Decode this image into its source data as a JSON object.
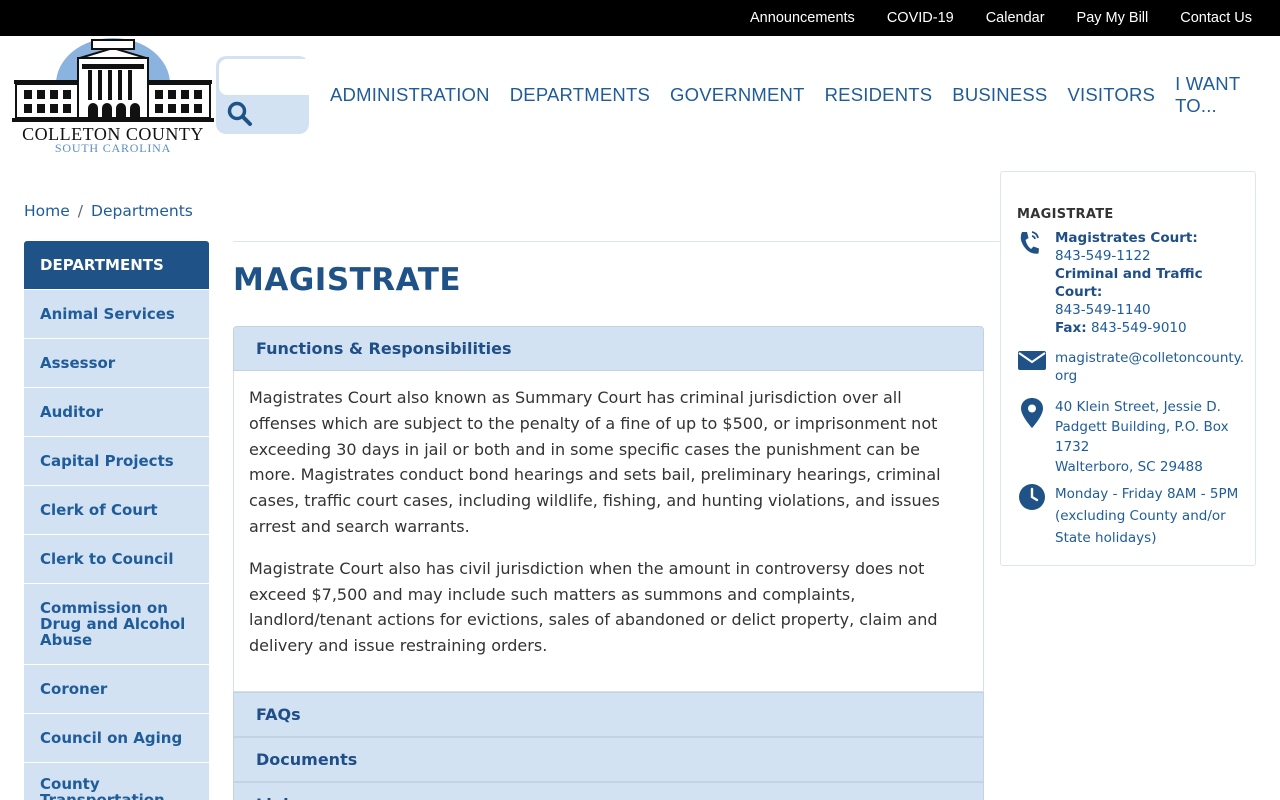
{
  "top_links": [
    "Announcements",
    "COVID-19",
    "Calendar",
    "Pay My Bill",
    "Contact Us"
  ],
  "logo": {
    "name": "COLLETON COUNTY",
    "state": "SOUTH CAROLINA"
  },
  "search": {
    "placeholder": ""
  },
  "main_nav": [
    "ADMINISTRATION",
    "DEPARTMENTS",
    "GOVERNMENT",
    "RESIDENTS",
    "BUSINESS",
    "VISITORS",
    "I WANT TO..."
  ],
  "breadcrumb": {
    "home": "Home",
    "separator": "/",
    "current": "Departments"
  },
  "sidenav": {
    "heading": "DEPARTMENTS",
    "items": [
      "Animal Services",
      "Assessor",
      "Auditor",
      "Capital Projects",
      "Clerk of Court",
      "Clerk to Council",
      "Commission on Drug and Alcohol Abuse",
      "Coroner",
      "Council on Aging",
      "County Transportation"
    ]
  },
  "page": {
    "title": "MAGISTRATE",
    "accordion": [
      {
        "label": "Functions & Responsibilities",
        "expanded": true
      },
      {
        "label": "FAQs",
        "expanded": false
      },
      {
        "label": "Documents",
        "expanded": false
      },
      {
        "label": "Links",
        "expanded": false
      }
    ],
    "body": [
      "Magistrates Court also known as Summary Court has criminal jurisdiction over all offenses which are subject to the penalty of a fine of up to $500, or imprisonment not exceeding 30 days in jail or both and in some specific cases the punishment can be more. Magistrates conduct bond hearings and sets bail, preliminary hearings, criminal cases, traffic court cases, including wildlife, fishing, and hunting violations, and issues arrest and search warrants.",
      "Magistrate Court also has civil jurisdiction when the amount in controversy does not exceed $7,500 and may include such matters as summons and complaints, landlord/tenant actions for evictions, sales of abandoned or delict property, claim and delivery and issue restraining orders."
    ]
  },
  "contact": {
    "title": "MAGISTRATE",
    "phone": {
      "label1": "Magistrates Court:",
      "number1": "843-549-1122",
      "label2": "Criminal and Traffic Court:",
      "number2": "843-549-1140",
      "fax_label": "Fax:",
      "fax": "843-549-9010"
    },
    "email": "magistrate@colletoncounty.org",
    "address": [
      "40 Klein Street, Jessie D. Padgett Building, P.O. Box 1732",
      "Walterboro, SC 29488"
    ],
    "hours": "Monday - Friday 8AM - 5PM (excluding County and/or State holidays)"
  },
  "colors": {
    "primary": "#1f5287",
    "link": "#1f5c99",
    "light_panel": "#d3e2f3",
    "topbar": "#000000"
  }
}
